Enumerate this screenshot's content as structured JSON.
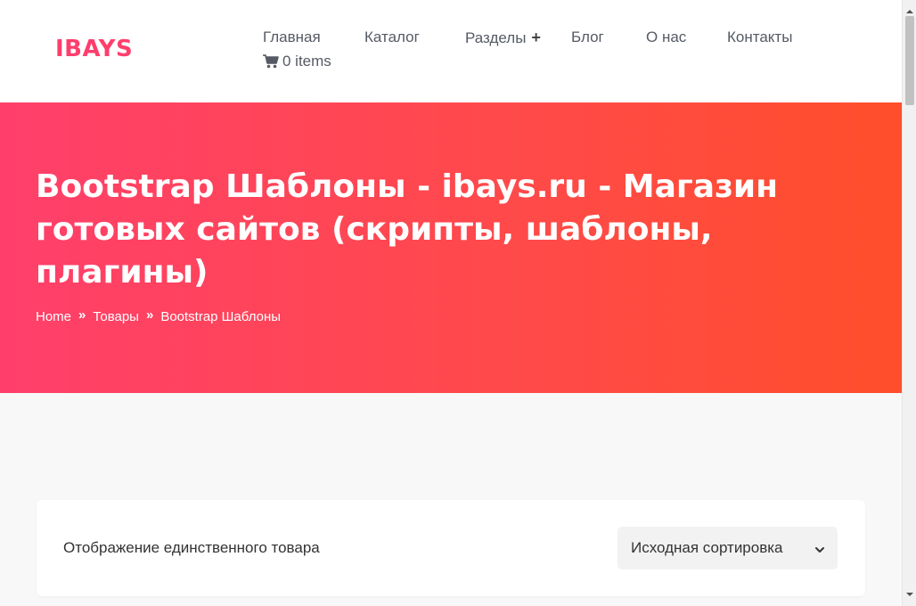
{
  "header": {
    "logo": "IBAYS",
    "nav": [
      {
        "label": "Главная"
      },
      {
        "label": "Каталог"
      },
      {
        "label": "Разделы",
        "expand": "+"
      },
      {
        "label": "Блог"
      },
      {
        "label": "О нас"
      },
      {
        "label": "Контакты"
      }
    ],
    "cart": {
      "label": "0 items",
      "icon": "cart-icon"
    }
  },
  "hero": {
    "title": "Bootstrap Шаблоны - ibays.ru - Магазин готовых сайтов (скрипты, шаблоны, плагины)",
    "breadcrumb": [
      {
        "label": "Home"
      },
      {
        "label": "Товары"
      },
      {
        "label": "Bootstrap Шаблоны"
      }
    ],
    "separator": "»"
  },
  "shop": {
    "result_count": "Отображение единственного товара",
    "sort": {
      "selected": "Исходная сортировка"
    }
  },
  "colors": {
    "accent": "#ff3e6c",
    "gradient_start": "#ff3f6b",
    "gradient_end": "#ff4e2b"
  }
}
